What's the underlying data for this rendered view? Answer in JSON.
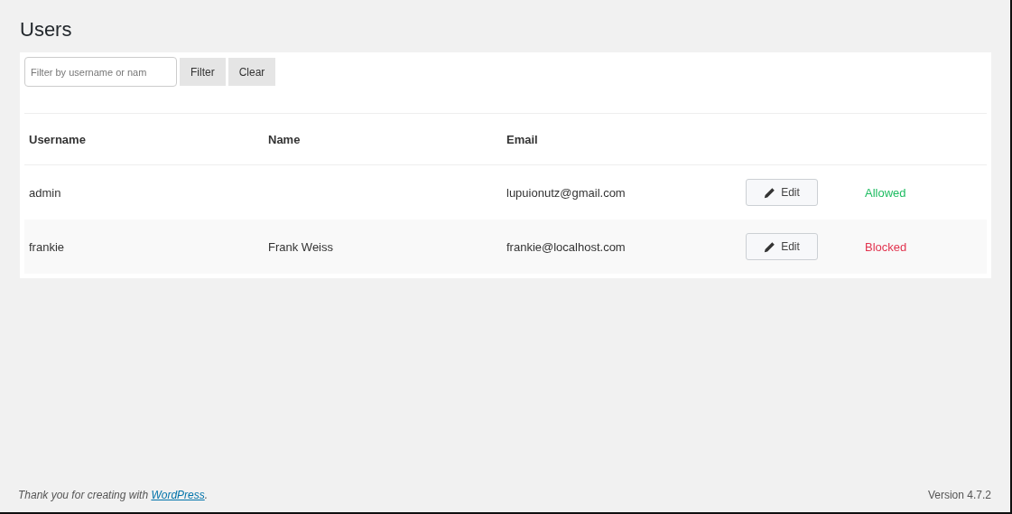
{
  "page_title": "Users",
  "filter": {
    "placeholder": "Filter by username or nam",
    "buttons": [
      "Filter",
      "Clear"
    ]
  },
  "table": {
    "columns": [
      "Username",
      "Name",
      "Email"
    ],
    "rows": [
      {
        "username": "admin",
        "email": "lupuionutz@gmail.com",
        "edit": "Edit",
        "status": "Allowed",
        "color": "#1ebc61"
      },
      {
        "username": "frankie",
        "name": "Frank Weiss",
        "email": "frankie@localhost.com",
        "edit": "Edit",
        "status": "Blocked",
        "color": "#e2344f"
      }
    ]
  },
  "footer": {
    "before": "Thank you for creating with ",
    "link": "WordPress",
    "after": ".",
    "version": "Version 4.7.2"
  }
}
